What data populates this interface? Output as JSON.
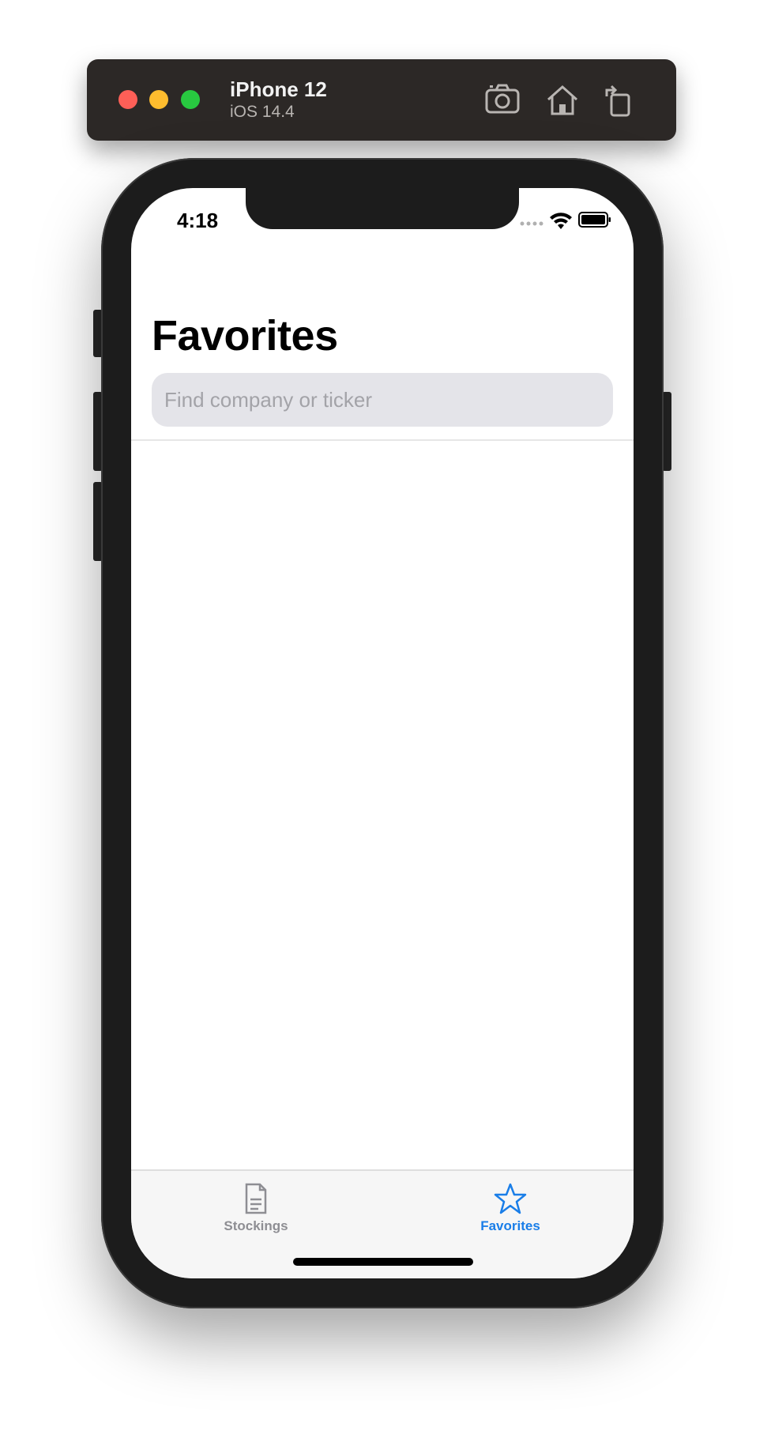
{
  "simulator": {
    "device_name": "iPhone 12",
    "os_version": "iOS 14.4",
    "buttons": [
      {
        "name": "screenshot",
        "icon": "camera-icon"
      },
      {
        "name": "home",
        "icon": "home-icon"
      },
      {
        "name": "rotate",
        "icon": "rotate-icon"
      }
    ]
  },
  "status_bar": {
    "time": "4:18",
    "icons": [
      "signal-icon",
      "wifi-icon",
      "battery-icon"
    ]
  },
  "page": {
    "title": "Favorites"
  },
  "search": {
    "placeholder": "Find company or ticker",
    "value": ""
  },
  "tab_bar": {
    "tabs": [
      {
        "label": "Stockings",
        "icon": "document-icon",
        "selected": false
      },
      {
        "label": "Favorites",
        "icon": "star-icon",
        "selected": true
      }
    ]
  },
  "colors": {
    "accent": "#1a7ee8",
    "inactive_tab": "#8e8e93",
    "search_bg": "#e4e4e9",
    "sim_bar": "#2c2826"
  }
}
